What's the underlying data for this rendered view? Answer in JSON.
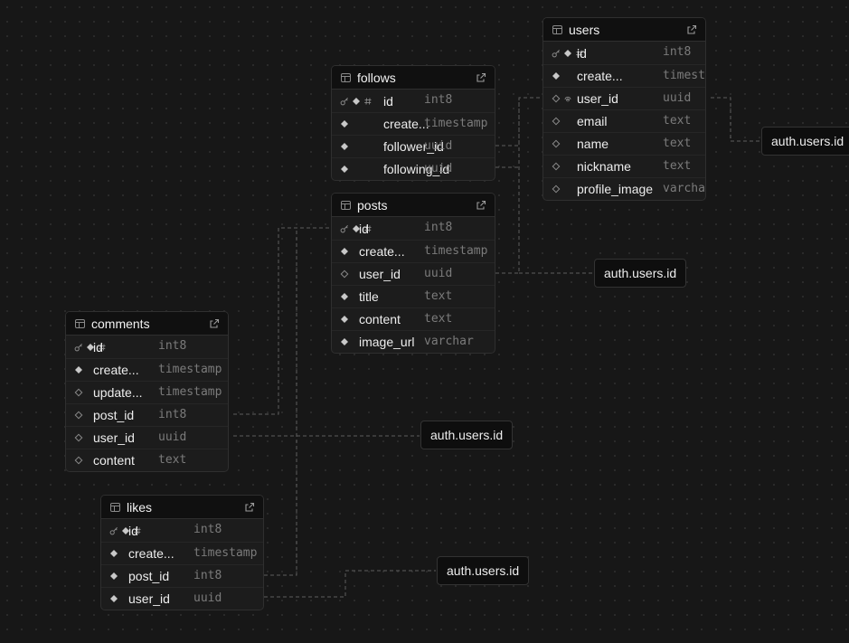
{
  "tables": [
    {
      "id": "users",
      "name": "users",
      "columns": [
        {
          "name": "id",
          "type": "int8",
          "icons": [
            "key-icon",
            "diamond-filled-icon",
            "hash-icon"
          ]
        },
        {
          "name": "create...",
          "type": "timestamp",
          "icons": [
            "diamond-filled-icon"
          ]
        },
        {
          "name": "user_id",
          "type": "uuid",
          "icons": [
            "diamond-outline-icon",
            "fingerprint-icon"
          ]
        },
        {
          "name": "email",
          "type": "text",
          "icons": [
            "diamond-outline-icon"
          ]
        },
        {
          "name": "name",
          "type": "text",
          "icons": [
            "diamond-outline-icon"
          ]
        },
        {
          "name": "nickname",
          "type": "text",
          "icons": [
            "diamond-outline-icon"
          ]
        },
        {
          "name": "profile_image",
          "type": "varchar",
          "icons": [
            "diamond-outline-icon"
          ]
        }
      ]
    },
    {
      "id": "follows",
      "name": "follows",
      "columns": [
        {
          "name": "id",
          "type": "int8",
          "icons": [
            "key-icon",
            "diamond-filled-icon",
            "hash-icon"
          ]
        },
        {
          "name": "create...",
          "type": "timestamp",
          "icons": [
            "diamond-filled-icon"
          ]
        },
        {
          "name": "follower_id",
          "type": "uuid",
          "icons": [
            "diamond-filled-icon"
          ]
        },
        {
          "name": "following_id",
          "type": "uuid",
          "icons": [
            "diamond-filled-icon"
          ]
        }
      ]
    },
    {
      "id": "posts",
      "name": "posts",
      "columns": [
        {
          "name": "id",
          "type": "int8",
          "icons": [
            "key-icon",
            "diamond-filled-icon",
            "hash-icon"
          ]
        },
        {
          "name": "create...",
          "type": "timestamp",
          "icons": [
            "diamond-filled-icon"
          ]
        },
        {
          "name": "user_id",
          "type": "uuid",
          "icons": [
            "diamond-outline-icon"
          ]
        },
        {
          "name": "title",
          "type": "text",
          "icons": [
            "diamond-filled-icon"
          ]
        },
        {
          "name": "content",
          "type": "text",
          "icons": [
            "diamond-filled-icon"
          ]
        },
        {
          "name": "image_url",
          "type": "varchar",
          "icons": [
            "diamond-filled-icon"
          ]
        }
      ]
    },
    {
      "id": "comments",
      "name": "comments",
      "columns": [
        {
          "name": "id",
          "type": "int8",
          "icons": [
            "key-icon",
            "diamond-filled-icon",
            "hash-icon"
          ]
        },
        {
          "name": "create...",
          "type": "timestamp",
          "icons": [
            "diamond-filled-icon"
          ]
        },
        {
          "name": "update...",
          "type": "timestamp",
          "icons": [
            "diamond-outline-icon"
          ]
        },
        {
          "name": "post_id",
          "type": "int8",
          "icons": [
            "diamond-outline-icon"
          ]
        },
        {
          "name": "user_id",
          "type": "uuid",
          "icons": [
            "diamond-outline-icon"
          ]
        },
        {
          "name": "content",
          "type": "text",
          "icons": [
            "diamond-outline-icon"
          ]
        }
      ]
    },
    {
      "id": "likes",
      "name": "likes",
      "columns": [
        {
          "name": "id",
          "type": "int8",
          "icons": [
            "key-icon",
            "diamond-filled-icon",
            "hash-icon"
          ]
        },
        {
          "name": "create...",
          "type": "timestamp",
          "icons": [
            "diamond-filled-icon"
          ]
        },
        {
          "name": "post_id",
          "type": "int8",
          "icons": [
            "diamond-filled-icon"
          ]
        },
        {
          "name": "user_id",
          "type": "uuid",
          "icons": [
            "diamond-filled-icon"
          ]
        }
      ]
    }
  ],
  "references": [
    {
      "id": "ref-users",
      "label": "auth.users.id"
    },
    {
      "id": "ref-posts",
      "label": "auth.users.id"
    },
    {
      "id": "ref-comments",
      "label": "auth.users.id"
    },
    {
      "id": "ref-likes",
      "label": "auth.users.id"
    }
  ],
  "colors": {
    "canvas": "#171717",
    "table_bg": "#1c1c1c",
    "header_bg": "#101010",
    "edge": "#5a5a5a"
  }
}
